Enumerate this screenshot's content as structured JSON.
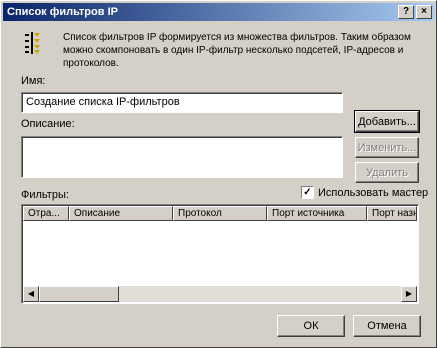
{
  "window": {
    "title": "Список фильтров IP",
    "help_button": "?",
    "close_button": "×"
  },
  "intro": {
    "icon": "filter-list-icon",
    "text": "Список фильтров IP формируется из множества фильтров. Таким образом можно скомпоновать в один IP-фильтр несколько подсетей, IP-адресов и протоколов."
  },
  "name_field": {
    "label": "Имя:",
    "value": "Создание списка IP-фильтров"
  },
  "description_field": {
    "label": "Описание:",
    "value": ""
  },
  "buttons": {
    "add": "Добавить...",
    "edit": "Изменить...",
    "remove": "Удалить",
    "ok": "ОК",
    "cancel": "Отмена"
  },
  "filters": {
    "label": "Фильтры:",
    "wizard_checkbox_label": "Использовать мастер",
    "wizard_checked": true,
    "columns": [
      "Отра...",
      "Описание",
      "Протокол",
      "Порт источника",
      "Порт назн"
    ]
  }
}
